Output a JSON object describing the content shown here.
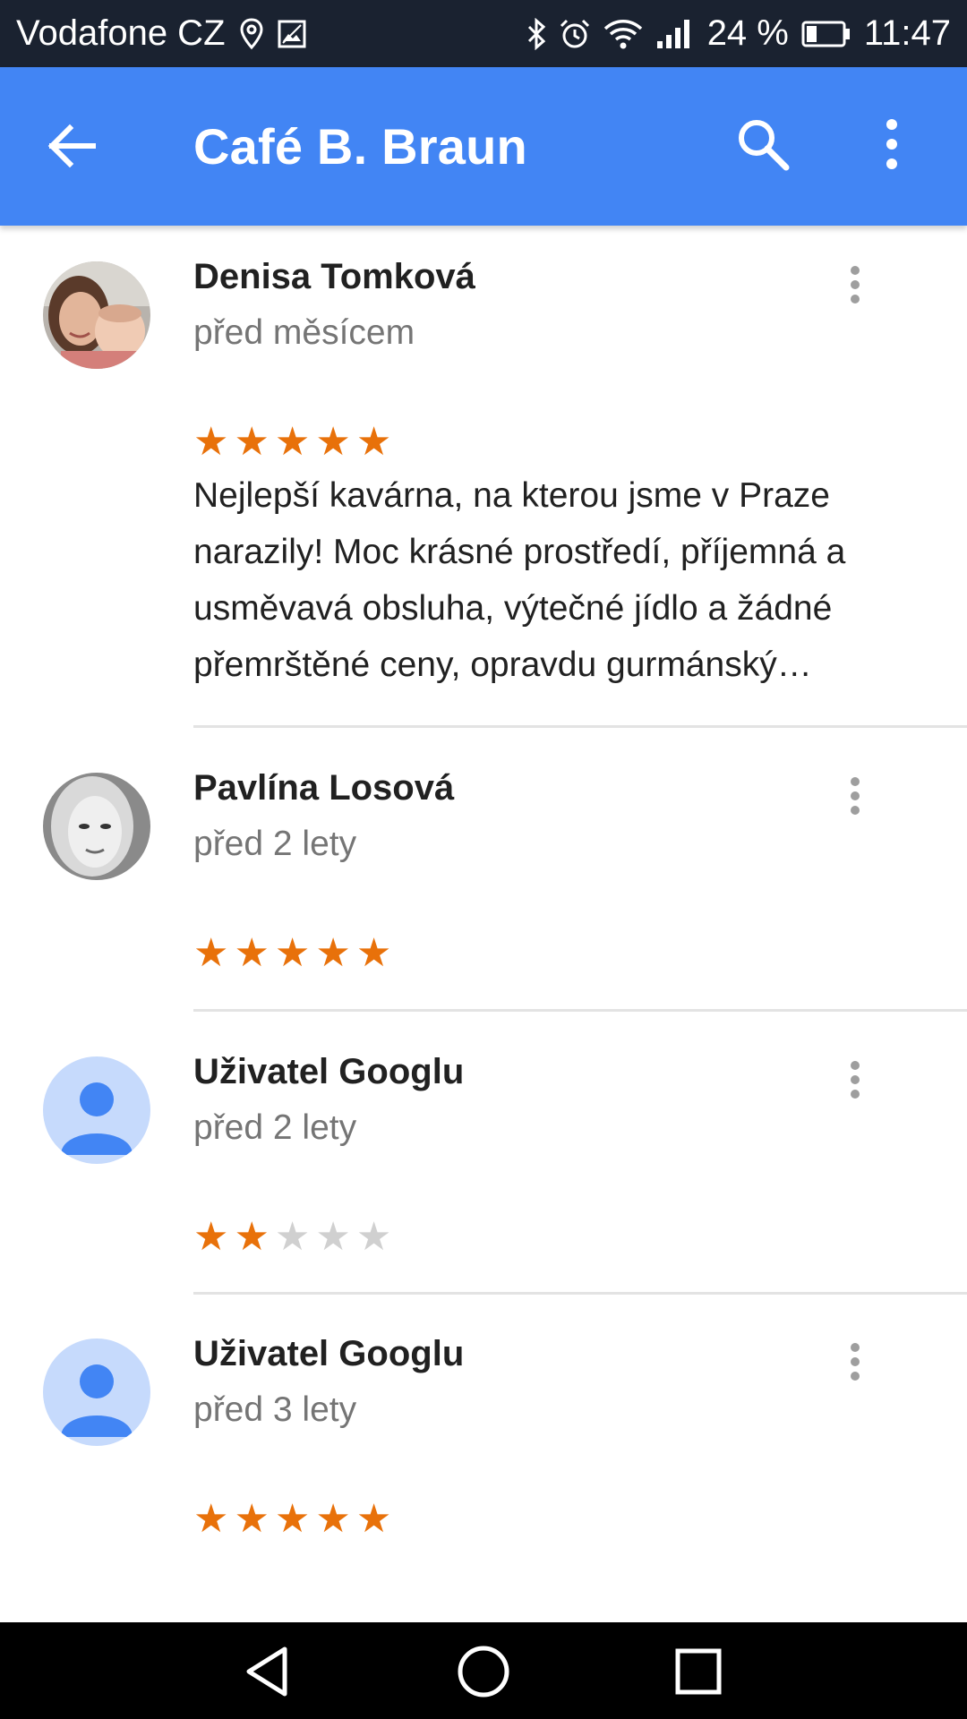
{
  "status_bar": {
    "carrier": "Vodafone CZ",
    "battery_percent": "24 %",
    "time": "11:47",
    "icons": [
      "location-icon",
      "image-icon",
      "bluetooth-icon",
      "alarm-icon",
      "wifi-icon",
      "signal-icon",
      "battery-icon"
    ]
  },
  "app_bar": {
    "title": "Café B. Braun",
    "icons": [
      "back-arrow-icon",
      "search-icon",
      "more-vert-icon"
    ]
  },
  "reviews": [
    {
      "author": "Denisa Tomková",
      "time": "před měsícem",
      "rating": 5,
      "text": "Nejlepší kavárna, na kterou jsme v Praze narazily! Moc krásné prostředí, příjemná a usměvavá obsluha, výtečné jídlo a žádné přemrštěné ceny, opravdu gurmánský…",
      "avatar": "photo"
    },
    {
      "author": "Pavlína Losová",
      "time": "před 2 lety",
      "rating": 5,
      "text": "",
      "avatar": "photo"
    },
    {
      "author": "Uživatel Googlu",
      "time": "před 2 lety",
      "rating": 2,
      "text": "",
      "avatar": "default-person-icon"
    },
    {
      "author": "Uživatel Googlu",
      "time": "před 3 lety",
      "rating": 5,
      "text": "",
      "avatar": "default-person-icon"
    }
  ],
  "colors": {
    "app_bar": "#4285f4",
    "status_bar": "#1a2230",
    "star_filled": "#e8710a",
    "star_empty": "#d0d0d0",
    "default_avatar_bg": "#c6dafc",
    "default_avatar_fg": "#4285f4"
  },
  "nav_bar": {
    "icons": [
      "nav-back-icon",
      "nav-home-icon",
      "nav-recents-icon"
    ]
  }
}
